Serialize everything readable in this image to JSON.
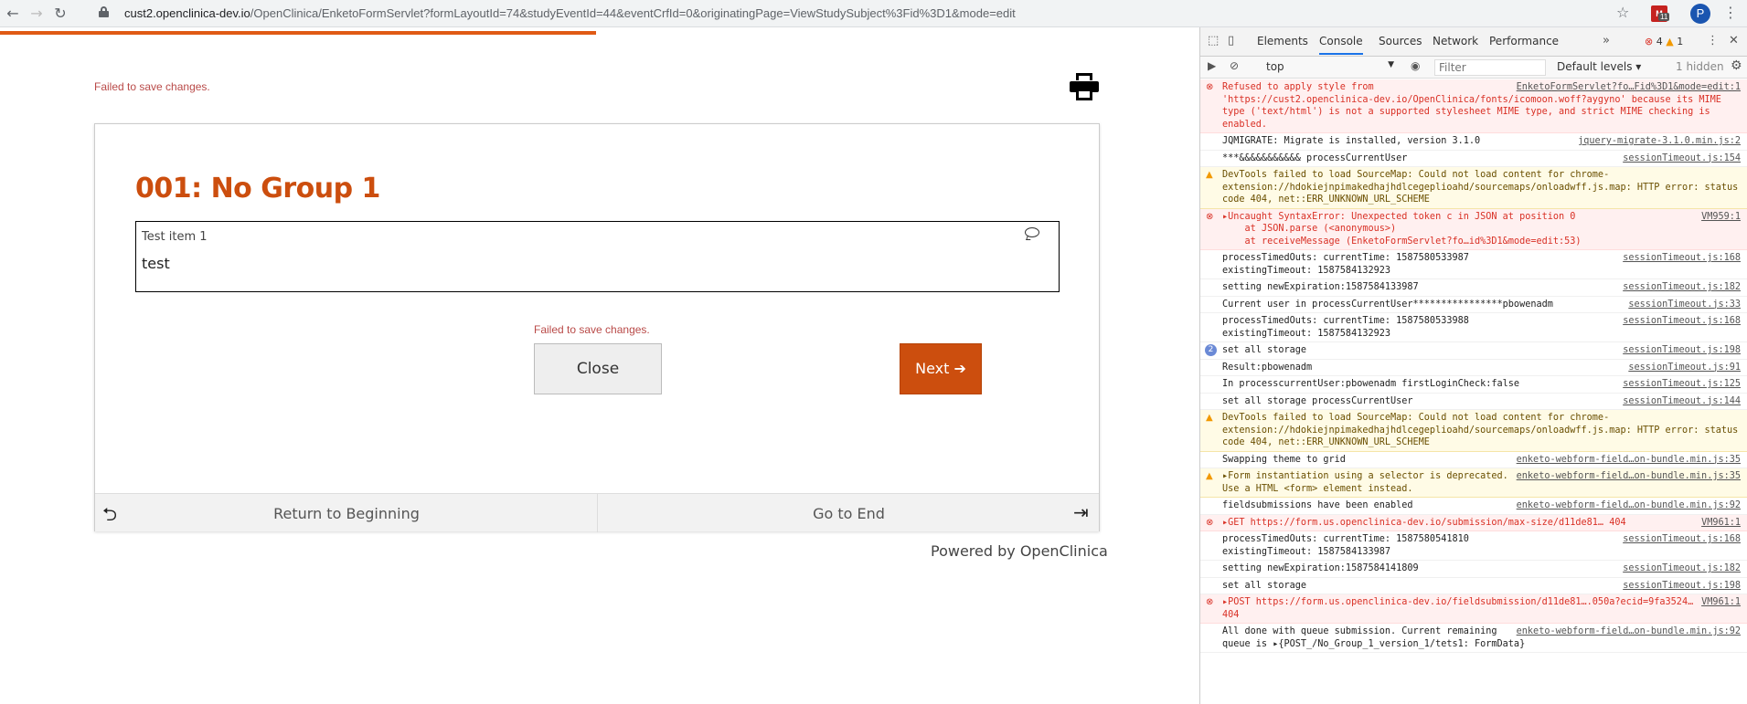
{
  "browser": {
    "url_host": "cust2.openclinica-dev.io",
    "url_path": "/OpenClinica/EnketoFormServlet?formLayoutId=74&studyEventId=44&eventCrfId=0&originatingPage=ViewStudySubject%3Fid%3D1&mode=edit",
    "extension_badge": "11",
    "profile_initial": "P"
  },
  "page": {
    "top_error": "Failed to save changes.",
    "group_title": "001: No Group 1",
    "question_label": "Test item 1",
    "question_value": "test",
    "mid_error": "Failed to save changes.",
    "close_label": "Close",
    "next_label": "Next ➔",
    "return_label": "Return to Beginning",
    "end_label": "Go to End",
    "powered_by": "Powered by OpenClinica"
  },
  "devtools": {
    "tabs": [
      "Elements",
      "Console",
      "Sources",
      "Network",
      "Performance"
    ],
    "error_count": "4",
    "warning_count": "1",
    "context": "top",
    "filter_placeholder": "Filter",
    "levels": "Default levels",
    "hidden": "1 hidden",
    "logs": [
      {
        "type": "err",
        "text": "Refused to apply style from 'https://cust2.openclinica-dev.io/OpenClinica/fonts/icomoon.woff?aygyno' because its MIME type ('text/html') is not a supported stylesheet MIME type, and strict MIME checking is enabled.",
        "src": "EnketoFormServlet?fo…Fid%3D1&mode=edit:1"
      },
      {
        "type": "log",
        "text": "JQMIGRATE: Migrate is installed, version 3.1.0",
        "src": "jquery-migrate-3.1.0.min.js:2"
      },
      {
        "type": "log",
        "text": "***&&&&&&&&&&& processCurrentUser",
        "src": "sessionTimeout.js:154"
      },
      {
        "type": "warn",
        "text": "DevTools failed to load SourceMap: Could not load content for chrome-extension://hdokiejnpimakedhajhdlcegeplioahd/sourcemaps/onloadwff.js.map: HTTP error: status code 404, net::ERR_UNKNOWN_URL_SCHEME",
        "src": ""
      },
      {
        "type": "err",
        "text": "▸Uncaught SyntaxError: Unexpected token c in JSON at position 0\n    at JSON.parse (<anonymous>)\n    at receiveMessage (EnketoFormServlet?fo…id%3D1&mode=edit:53)",
        "src": "VM959:1"
      },
      {
        "type": "log",
        "text": "processTimedOuts: currentTime: 1587580533987\nexistingTimeout: 1587584132923",
        "src": "sessionTimeout.js:168"
      },
      {
        "type": "log",
        "text": "setting newExpiration:1587584133987",
        "src": "sessionTimeout.js:182"
      },
      {
        "type": "log",
        "text": "Current user in processCurrentUser****************pbowenadm",
        "src": "sessionTimeout.js:33"
      },
      {
        "type": "log",
        "text": "processTimedOuts: currentTime: 1587580533988\nexistingTimeout: 1587584132923",
        "src": "sessionTimeout.js:168"
      },
      {
        "type": "log",
        "count": "2",
        "text": "set all storage",
        "src": "sessionTimeout.js:198"
      },
      {
        "type": "log",
        "text": "Result:pbowenadm",
        "src": "sessionTimeout.js:91"
      },
      {
        "type": "log",
        "text": "In processcurrentUser:pbowenadm firstLoginCheck:false",
        "src": "sessionTimeout.js:125"
      },
      {
        "type": "log",
        "text": "set all storage processCurrentUser",
        "src": "sessionTimeout.js:144"
      },
      {
        "type": "warn",
        "text": "DevTools failed to load SourceMap: Could not load content for chrome-extension://hdokiejnpimakedhajhdlcegeplioahd/sourcemaps/onloadwff.js.map: HTTP error: status code 404, net::ERR_UNKNOWN_URL_SCHEME",
        "src": ""
      },
      {
        "type": "log",
        "text": "Swapping theme to grid",
        "src": "enketo-webform-field…on-bundle.min.js:35"
      },
      {
        "type": "warn",
        "text": "▸Form instantiation using a selector is deprecated. Use a HTML <form> element instead.",
        "src": "enketo-webform-field…on-bundle.min.js:35"
      },
      {
        "type": "log",
        "text": "fieldsubmissions have been enabled",
        "src": "enketo-webform-field…on-bundle.min.js:92"
      },
      {
        "type": "err",
        "text": "▸GET https://form.us.openclinica-dev.io/submission/max-size/d11de81… 404",
        "src": "VM961:1"
      },
      {
        "type": "log",
        "text": "processTimedOuts: currentTime: 1587580541810\nexistingTimeout: 1587584133987",
        "src": "sessionTimeout.js:168"
      },
      {
        "type": "log",
        "text": "setting newExpiration:1587584141809",
        "src": "sessionTimeout.js:182"
      },
      {
        "type": "log",
        "text": "set all storage",
        "src": "sessionTimeout.js:198"
      },
      {
        "type": "err",
        "text": "▸POST https://form.us.openclinica-dev.io/fieldsubmission/d11de81….050a?ecid=9fa3524… 404",
        "src": "VM961:1"
      },
      {
        "type": "log",
        "text": "All done with queue submission. Current remaining queue is ▸{POST_/No_Group_1_version_1/tets1: FormData}",
        "src": "enketo-webform-field…on-bundle.min.js:92"
      }
    ]
  }
}
